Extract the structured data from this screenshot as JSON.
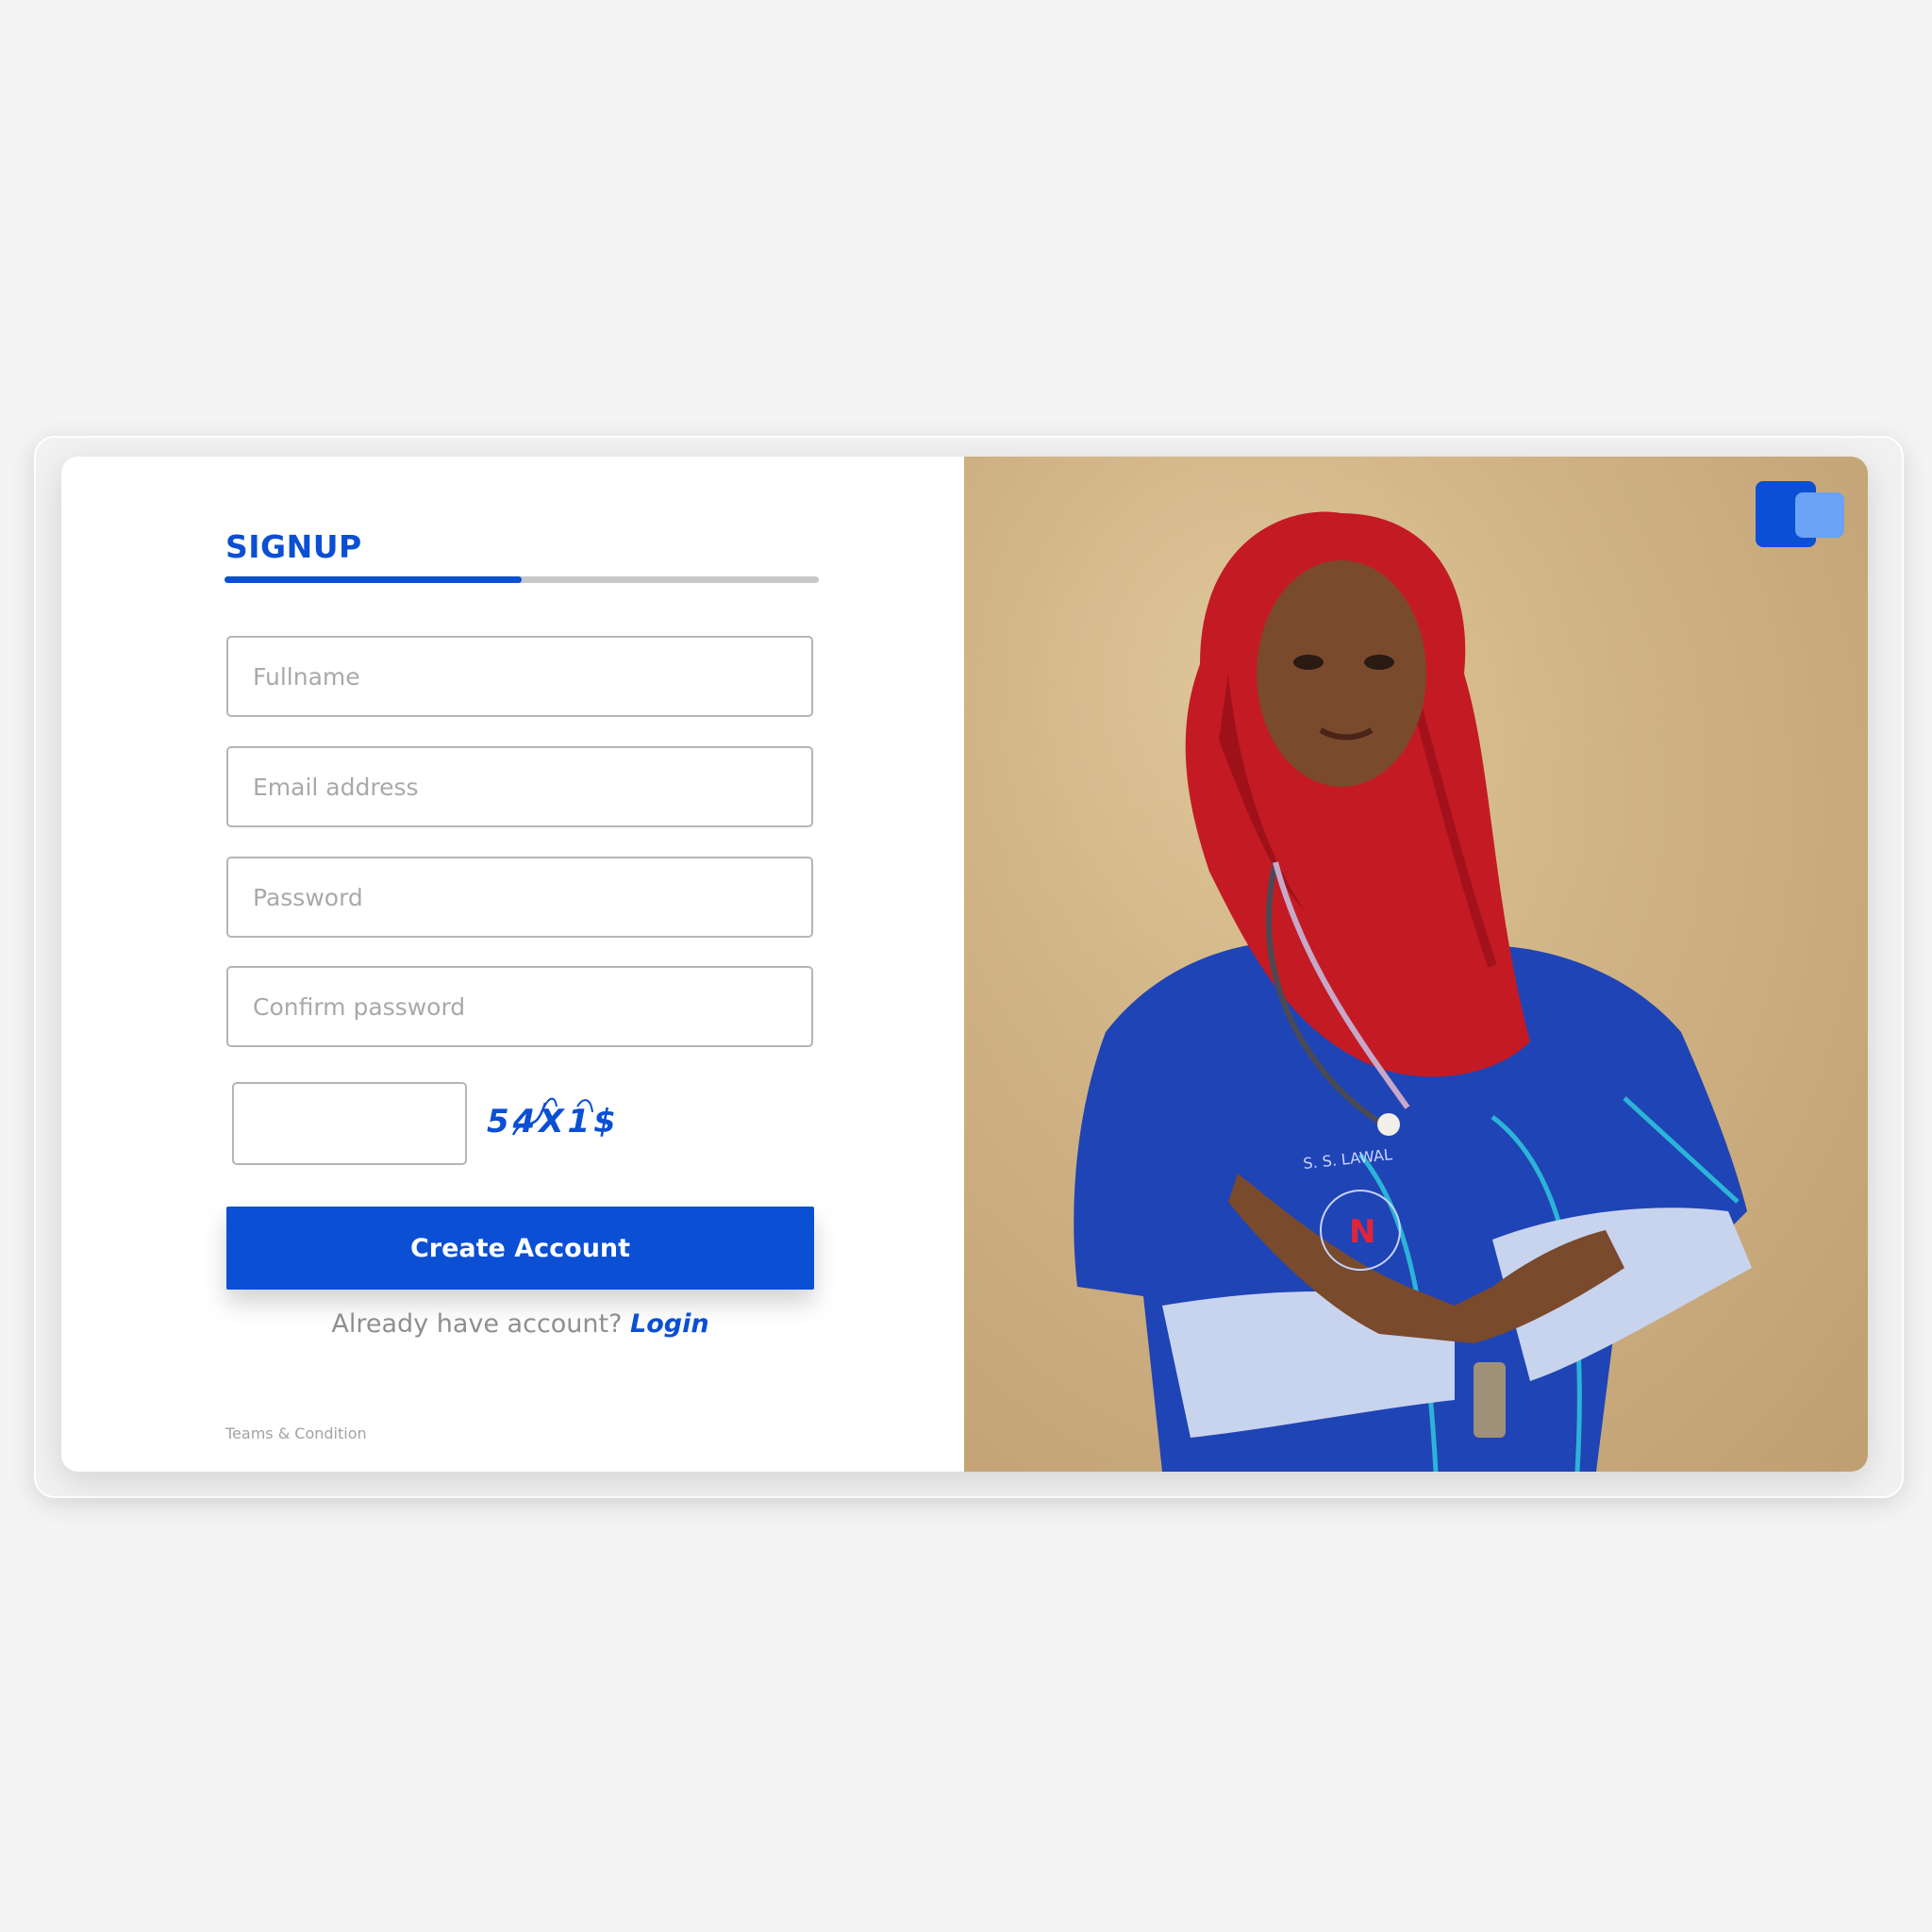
{
  "signup": {
    "title": "SIGNUP",
    "progress_fraction": 0.5
  },
  "fields": {
    "fullname_placeholder": "Fullname",
    "email_placeholder": "Email address",
    "password_placeholder": "Password",
    "confirm_password_placeholder": "Confirm password"
  },
  "captcha": {
    "code": "54X1$"
  },
  "actions": {
    "create_account_label": "Create Account",
    "login_prompt": "Already have account?",
    "login_label": "Login",
    "terms_label": "Teams & Condition"
  },
  "photo": {
    "badge_name": "S. S. LAWAL",
    "badge_letter": "N"
  },
  "colors": {
    "accent": "#0b4fd4",
    "logo_light": "#6aa3f5",
    "headscarf": "#c41a24",
    "scrubs": "#1f44b5",
    "background_photo": "#d3b685"
  },
  "icons": {
    "brand": "brand-logo-icon"
  }
}
